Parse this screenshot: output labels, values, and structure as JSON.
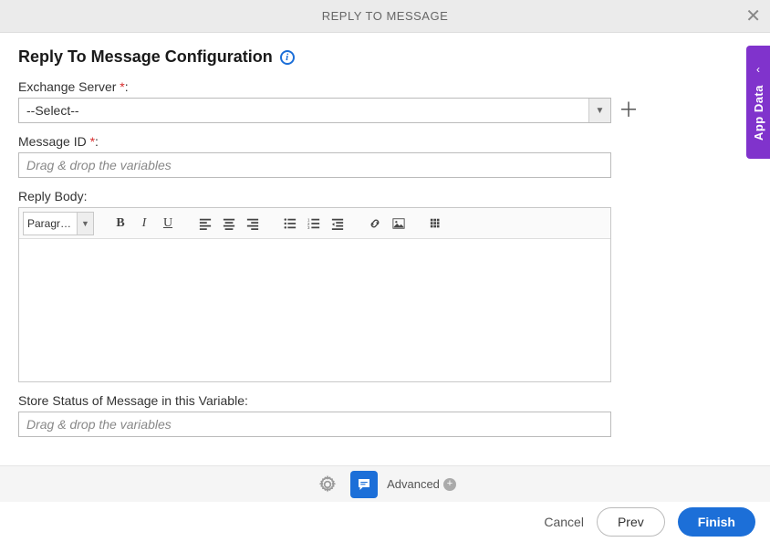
{
  "header": {
    "title": "REPLY TO MESSAGE"
  },
  "page": {
    "title": "Reply To Message Configuration"
  },
  "sidepanel": {
    "label": "App Data"
  },
  "fields": {
    "exchange": {
      "label": "Exchange Server ",
      "selected": "--Select--"
    },
    "messageId": {
      "label": "Message ID ",
      "placeholder": "Drag & drop the variables"
    },
    "replyBody": {
      "label": "Reply Body:"
    },
    "storeStatus": {
      "label": "Store Status of Message in this Variable:",
      "placeholder": "Drag & drop the variables"
    }
  },
  "editor": {
    "formatSelect": "Paragra…"
  },
  "bottomBar": {
    "advanced": "Advanced"
  },
  "footer": {
    "cancel": "Cancel",
    "prev": "Prev",
    "finish": "Finish"
  }
}
